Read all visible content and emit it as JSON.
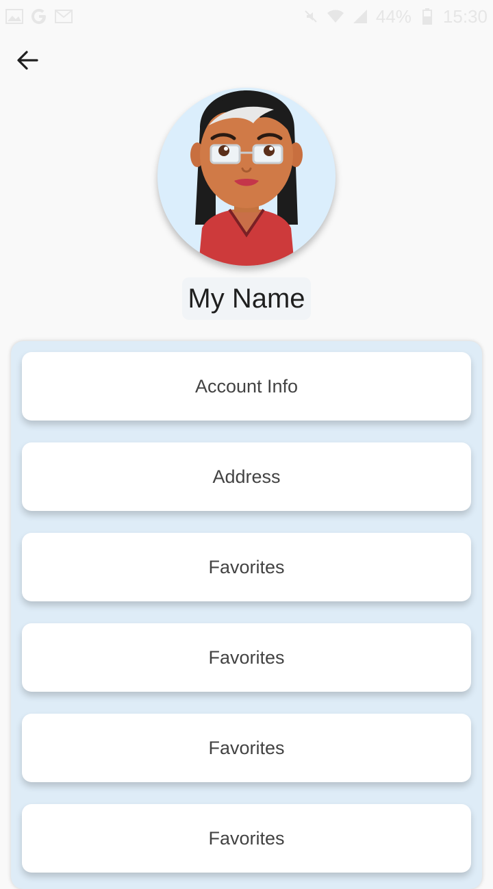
{
  "status_bar": {
    "left_icons": [
      "image-icon",
      "google-icon",
      "gmail-icon"
    ],
    "right_icons": [
      "mute-icon",
      "wifi-icon",
      "signal-icon"
    ],
    "battery": "44%",
    "time": "15:30"
  },
  "profile": {
    "name": "My Name"
  },
  "menu": {
    "items": [
      {
        "label": "Account Info"
      },
      {
        "label": "Address"
      },
      {
        "label": "Favorites"
      },
      {
        "label": "Favorites"
      },
      {
        "label": "Favorites"
      },
      {
        "label": "Favorites"
      }
    ]
  },
  "colors": {
    "page_background": "#f9f9f9",
    "avatar_background": "#dbeefc",
    "panel_background": "#deecf7",
    "card_background": "#ffffff",
    "text": "#424242"
  }
}
